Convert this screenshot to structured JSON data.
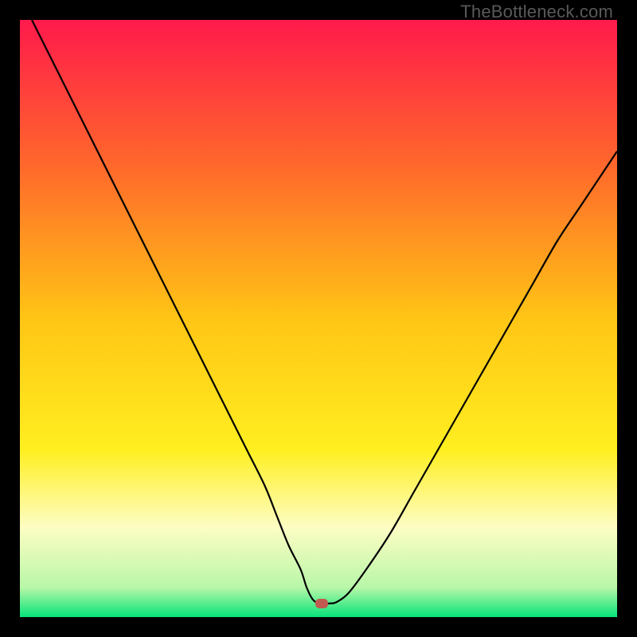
{
  "watermark": "TheBottleneck.com",
  "chart_data": {
    "type": "line",
    "title": "",
    "xlabel": "",
    "ylabel": "",
    "xlim": [
      0,
      100
    ],
    "ylim": [
      0,
      100
    ],
    "background_gradient": [
      {
        "stop": 0.0,
        "color": "#ff1a4b"
      },
      {
        "stop": 0.25,
        "color": "#ff6a2b"
      },
      {
        "stop": 0.5,
        "color": "#ffc515"
      },
      {
        "stop": 0.72,
        "color": "#ffef20"
      },
      {
        "stop": 0.85,
        "color": "#fdfdc4"
      },
      {
        "stop": 0.95,
        "color": "#b9f7a8"
      },
      {
        "stop": 1.0,
        "color": "#06e47a"
      }
    ],
    "series": [
      {
        "name": "bottleneck-curve",
        "color": "#000000",
        "x": [
          2,
          5,
          8,
          11,
          14,
          17,
          20,
          23,
          26,
          29,
          32,
          35,
          38,
          41,
          43,
          45,
          47,
          48,
          49,
          50,
          51,
          52,
          53,
          55,
          58,
          62,
          66,
          70,
          74,
          78,
          82,
          86,
          90,
          94,
          100
        ],
        "y": [
          100,
          94,
          88,
          82,
          76,
          70,
          64,
          58,
          52,
          46,
          40,
          34,
          28,
          22,
          17,
          12,
          8,
          5,
          3,
          2.3,
          2.3,
          2.3,
          2.5,
          4,
          8,
          14,
          21,
          28,
          35,
          42,
          49,
          56,
          63,
          69,
          78
        ]
      }
    ],
    "marker": {
      "x": 50.5,
      "y": 2.3,
      "color": "#c15b51"
    }
  }
}
